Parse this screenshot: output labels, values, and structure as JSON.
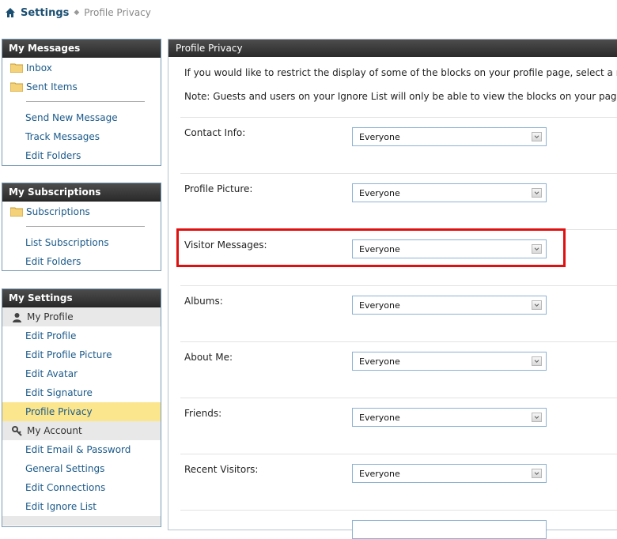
{
  "breadcrumb": {
    "root": "Settings",
    "current": "Profile Privacy"
  },
  "sidebar": {
    "messages": {
      "title": "My Messages",
      "folders": [
        "Inbox",
        "Sent Items"
      ],
      "links": [
        "Send New Message",
        "Track Messages",
        "Edit Folders"
      ]
    },
    "subscriptions": {
      "title": "My Subscriptions",
      "folders": [
        "Subscriptions"
      ],
      "links": [
        "List Subscriptions",
        "Edit Folders"
      ]
    },
    "settings": {
      "title": "My Settings",
      "profile_section": "My Profile",
      "profile_links": [
        "Edit Profile",
        "Edit Profile Picture",
        "Edit Avatar",
        "Edit Signature",
        "Profile Privacy"
      ],
      "account_section": "My Account",
      "account_links": [
        "Edit Email & Password",
        "General Settings",
        "Edit Connections",
        "Edit Ignore List"
      ]
    }
  },
  "main": {
    "title": "Profile Privacy",
    "intro": "If you would like to restrict the display of some of the blocks on your profile page, select a minir",
    "note": "Note: Guests and users on your Ignore List will only be able to view the blocks on your page whe",
    "fields": [
      {
        "label": "Contact Info:",
        "value": "Everyone"
      },
      {
        "label": "Profile Picture:",
        "value": "Everyone"
      },
      {
        "label": "Visitor Messages:",
        "value": "Everyone"
      },
      {
        "label": "Albums:",
        "value": "Everyone"
      },
      {
        "label": "About Me:",
        "value": "Everyone"
      },
      {
        "label": "Friends:",
        "value": "Everyone"
      },
      {
        "label": "Recent Visitors:",
        "value": "Everyone"
      }
    ]
  },
  "colors": {
    "link": "#1b5a8a",
    "header": "#333333",
    "active": "#fbe68e",
    "highlight": "#e01010"
  }
}
